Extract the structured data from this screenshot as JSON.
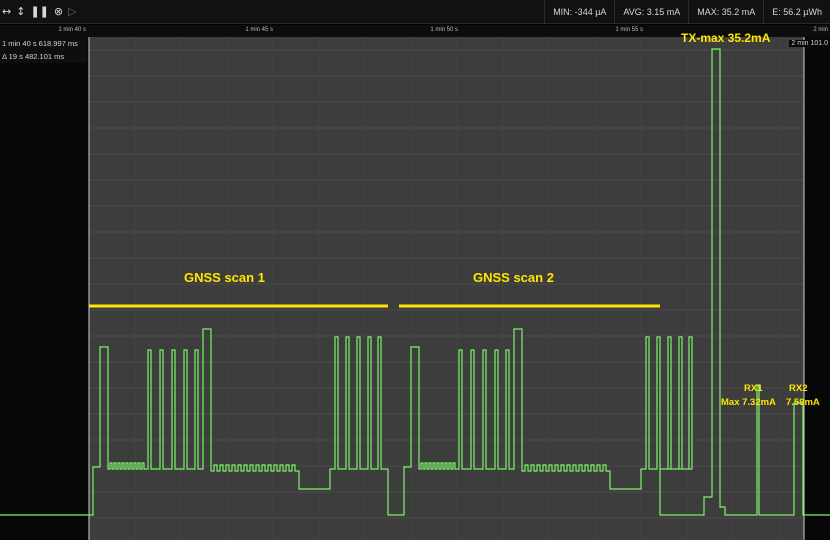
{
  "toolbar": {
    "icons": [
      "move-horizontal-icon",
      "move-vertical-icon",
      "pause-icon",
      "close-circle-icon",
      "play-icon"
    ]
  },
  "stats": {
    "min": "MIN: -344 µA",
    "avg": "AVG: 3.15 mA",
    "max": "MAX: 35.2 mA",
    "energy": "E: 56.2 µWh"
  },
  "time_axis": {
    "ticks": [
      "1 min 40 s",
      "1 min 45 s",
      "1 min 50 s",
      "1 min 55 s",
      "2 min"
    ]
  },
  "cursor_info": {
    "time": "1 min 40 s 618.997 ms",
    "delta": "Δ 19 s 482.101 ms"
  },
  "right_marker": "2 min 101.0",
  "annotations": {
    "gnss1": "GNSS scan 1",
    "gnss2": "GNSS scan 2",
    "tx": "TX-max 35.2mA",
    "rx1_title": "RX1",
    "rx1_value": "Max 7.32mA",
    "rx2_title": "RX2",
    "rx2_value": "7.59mA"
  },
  "colors": {
    "trace": "#7cf26a",
    "annotation": "#ffe600",
    "plot_background": "#3d3d3d",
    "outside_background": "#070707"
  }
}
